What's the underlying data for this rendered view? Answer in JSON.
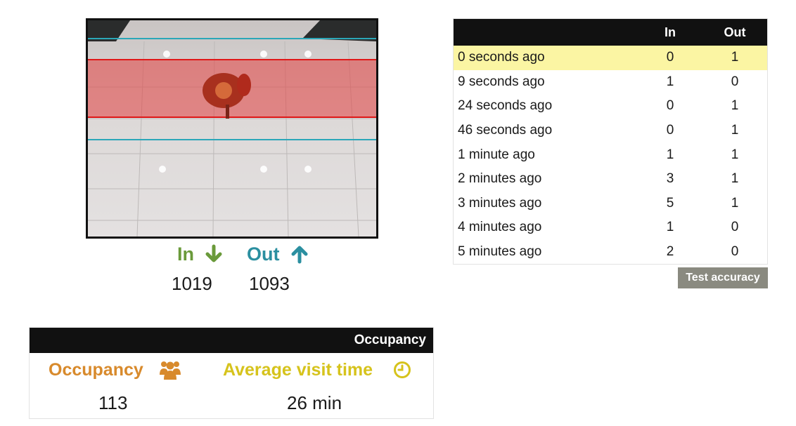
{
  "counters": {
    "in_label": "In",
    "out_label": "Out",
    "in_value": "1019",
    "out_value": "1093",
    "in_color": "#6a9a3a",
    "out_color": "#2b8fa0",
    "in_icon": "arrow-down-icon",
    "out_icon": "arrow-up-icon"
  },
  "history": {
    "headers": {
      "when": "",
      "in": "In",
      "out": "Out"
    },
    "rows": [
      {
        "when": "0 seconds ago",
        "in": "0",
        "out": "1"
      },
      {
        "when": "9 seconds ago",
        "in": "1",
        "out": "0"
      },
      {
        "when": "24 seconds ago",
        "in": "0",
        "out": "1"
      },
      {
        "when": "46 seconds ago",
        "in": "0",
        "out": "1"
      },
      {
        "when": "1 minute ago",
        "in": "1",
        "out": "1"
      },
      {
        "when": "2 minutes ago",
        "in": "3",
        "out": "1"
      },
      {
        "when": "3 minutes ago",
        "in": "5",
        "out": "1"
      },
      {
        "when": "4 minutes ago",
        "in": "1",
        "out": "0"
      },
      {
        "when": "5 minutes ago",
        "in": "2",
        "out": "0"
      }
    ],
    "highlight_color": "#fbf5a3"
  },
  "test_button": {
    "label": "Test accuracy"
  },
  "occupancy": {
    "header": "Occupancy",
    "occupancy_label": "Occupancy",
    "occupancy_value": "113",
    "occupancy_icon": "people-group-icon",
    "occupancy_color": "#d88a2c",
    "avg_label": "Average visit time",
    "avg_value": "26 min",
    "avg_icon": "clock-icon",
    "avg_color": "#d6c31c"
  }
}
